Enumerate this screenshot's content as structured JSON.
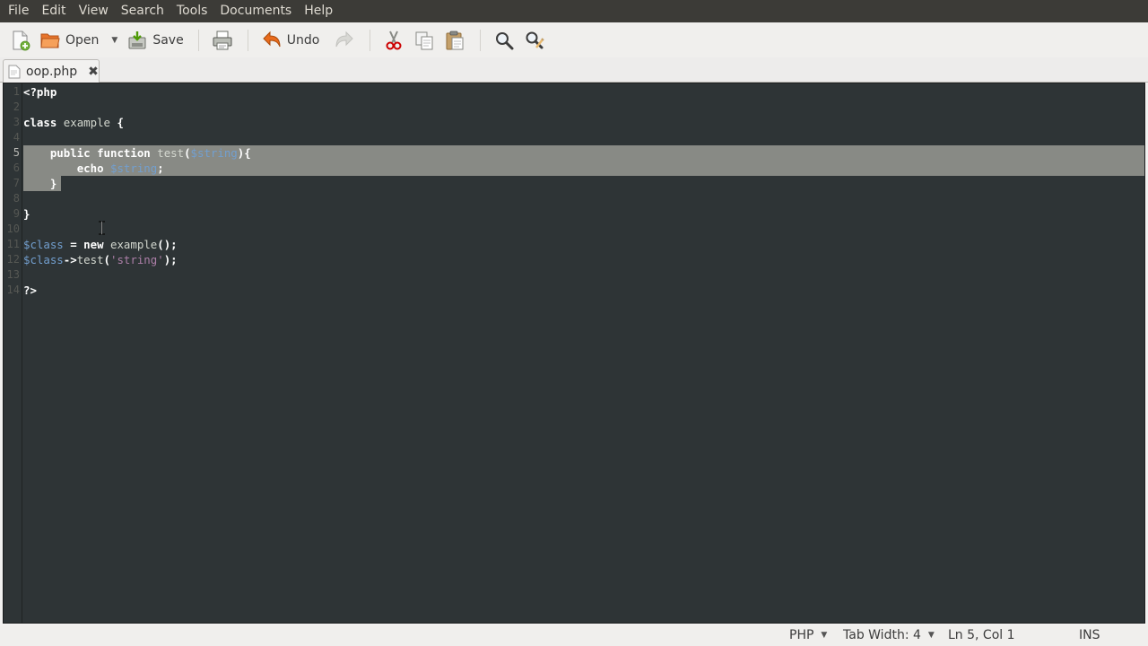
{
  "menubar": {
    "items": [
      "File",
      "Edit",
      "View",
      "Search",
      "Tools",
      "Documents",
      "Help"
    ]
  },
  "toolbar": {
    "new_icon": "new-document-icon",
    "open_label": "Open",
    "save_label": "Save",
    "print_icon": "printer-icon",
    "undo_label": "Undo",
    "redo_icon": "redo-icon",
    "cut_icon": "scissors-icon",
    "copy_icon": "copy-icon",
    "paste_icon": "paste-icon",
    "find_icon": "magnifier-icon",
    "replace_icon": "find-replace-icon"
  },
  "tabs": [
    {
      "label": "oop.php",
      "active": true
    }
  ],
  "editor": {
    "line_numbers": [
      "1",
      "2",
      "3",
      "4",
      "5",
      "6",
      "7",
      "8",
      "9",
      "10",
      "11",
      "12",
      "13",
      "14"
    ],
    "current_line": 5,
    "selected_lines": [
      5,
      6,
      7
    ],
    "lines": [
      "<?php",
      "",
      "class example {",
      "",
      "    public function test($string){",
      "        echo $string;",
      "    }",
      "",
      "}",
      "",
      "$class = new example();",
      "$class->test('string');",
      "",
      "?>"
    ],
    "colors": {
      "background": "#2e3436",
      "selection": "#888a85",
      "variable": "#729fcf",
      "string": "#ad7fa8",
      "keyword": "#ffffff"
    }
  },
  "statusbar": {
    "language": "PHP",
    "tab_width": "Tab Width: 4",
    "position": "Ln 5, Col 1",
    "mode": "INS"
  }
}
